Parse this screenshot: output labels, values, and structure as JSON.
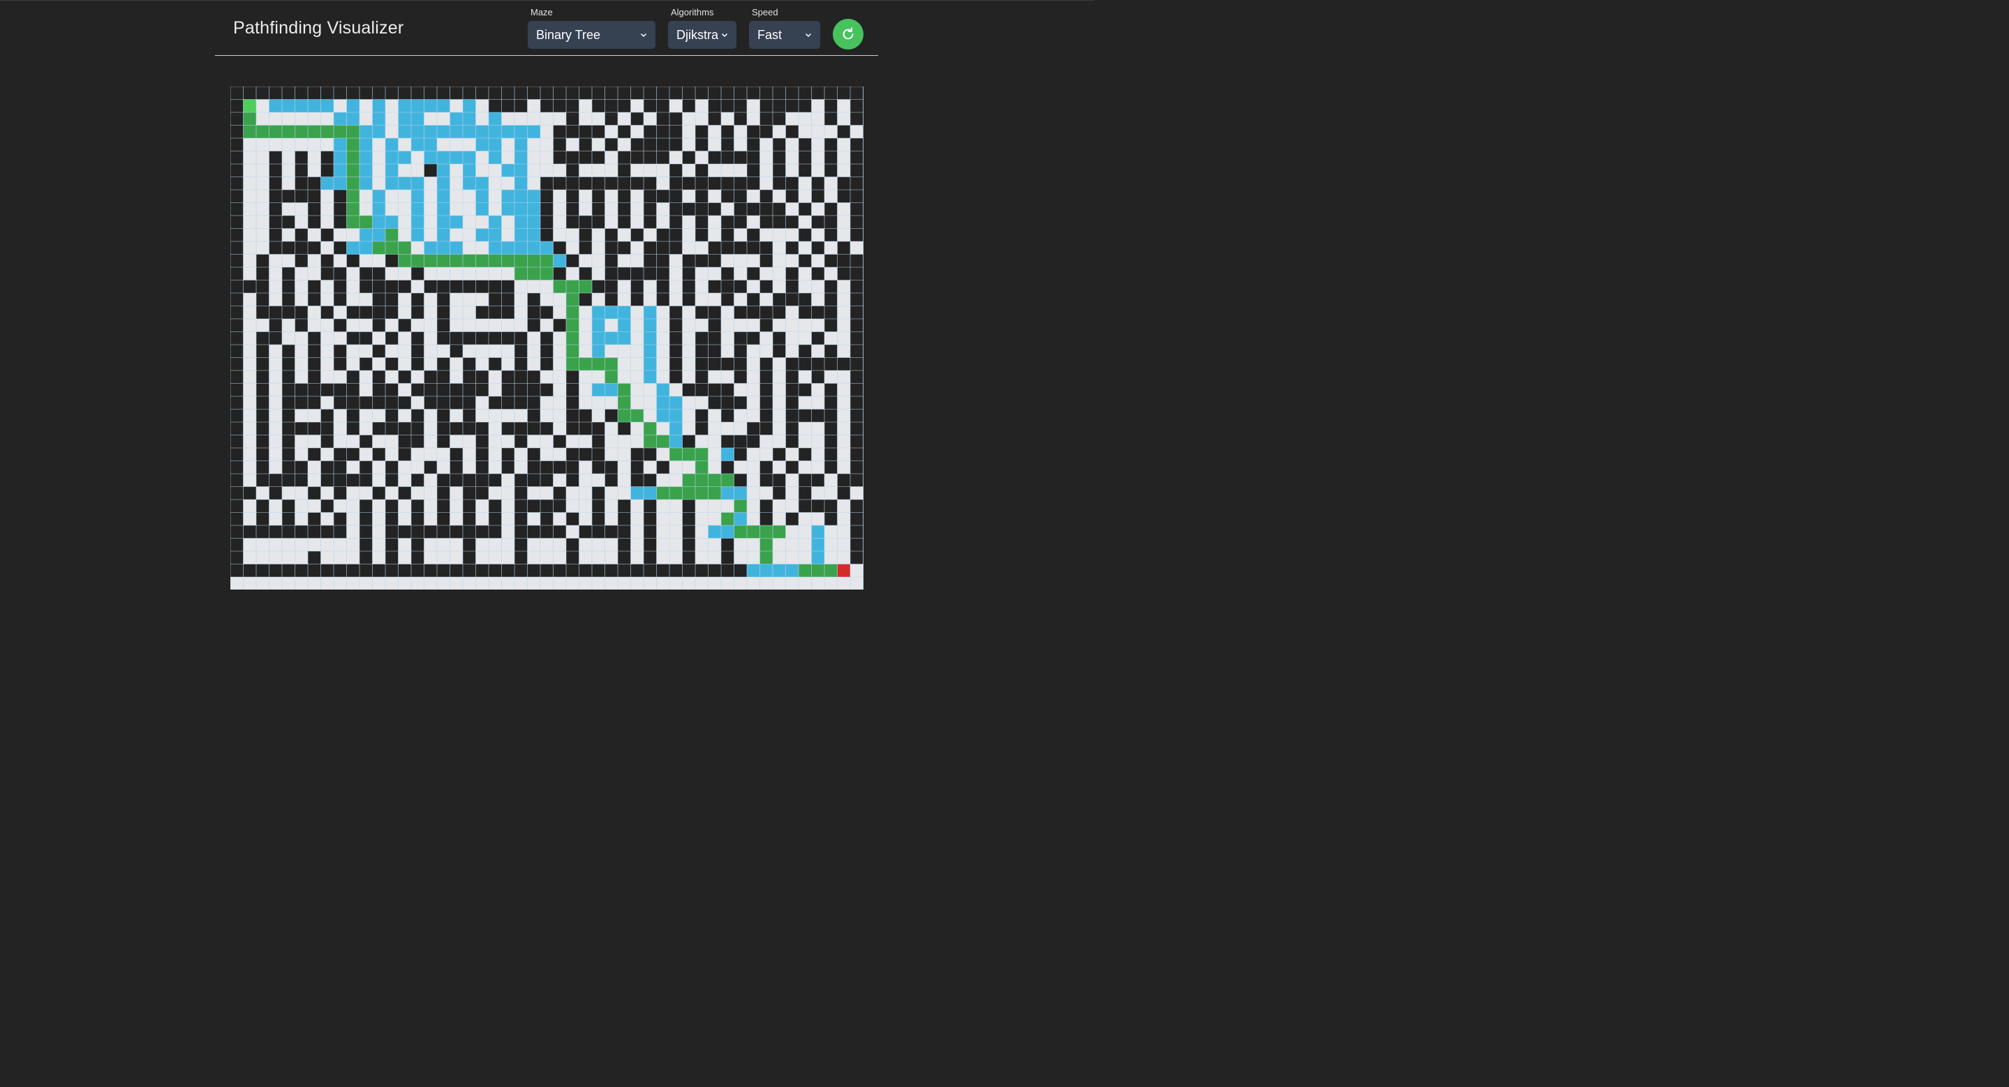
{
  "app": {
    "title": "Pathfinding Visualizer"
  },
  "controls": {
    "maze": {
      "label": "Maze",
      "value": "Binary Tree"
    },
    "algorithm": {
      "label": "Algorithms",
      "value": "Djikstra"
    },
    "speed": {
      "label": "Speed",
      "value": "Fast"
    },
    "reset_icon": "refresh-icon"
  },
  "colors": {
    "background": "#232323",
    "empty": "#e5e7eb",
    "wall": "#232323",
    "visited": "#41b4de",
    "path": "#3ba24c",
    "start": "#4fce5c",
    "end": "#d42a2a",
    "accent": "#48c25d",
    "select_bg": "#364152"
  },
  "grid": {
    "rows": 39,
    "cols": 49,
    "start": [
      1,
      1
    ],
    "end": [
      37,
      47
    ],
    "legend": "#=wall  .=empty  v=visited  p=path  S=start  E=end",
    "cells": [
      "#################################################",
      "#S.vvvvv.v.v.vvvv.v.###.###.###.##.#.###.####.#.#",
      "#p......vv.v.vv..vv.v.....#..#.#.##..#.#.##...#.#",
      "#pppppppppvv.vvvvvvvvvvv.####.#.###.#.#.##.#...#.#",
      "#.......vpv.v.vv...vv.v..#.#.#.####.#.#.#.#.#.#.#",
      "#..#.#.#vpv.vv.vvvv.v.v..####.####.#.####.#.#.#.#",
      "#..#.#.#vpv.v..#v.v..vv...#...#...#.#...#.#.#.#.#",
      "#..#.##vvpv.vvv.v.vv..v.#########.#######.##.#.##",
      "#..####.#p.v..v.v..v.vvv#.#.#.#.###.#.##.#.#.#.##",
      "#..#..#.#p.v..v.v..v.vvv#.#.#.#.#.####.####.#.#.#",
      "#..##.#.#ppvv.v.vv..v.vv#.###.#.#.#.#.##.###.##.#",
      "#..#.#.#..vvp.v.v..vv.vv#..#.#.#.##.#.#.#...#.#.#",
      "#..####.#vvppp.vvv..vvvvv#.#.##.###..#####.#.#.#.",
      "#.#..#.#.#..#ppppppppppppv#..#..##.###...#..#.###",
      "#.#.#..##.##..#.......ppp#.#.#####.#..#.#..#.#.##",
      "###.#.#.#.####.#######...ppp##.#.#.#.###.#.#..#.#",
      "#.#.#.#.#..##.#.#...##.#..p#.#.#.#.#..#.#.###.#.#",
      "#.####.#.####.#.#..###.##.p.vvv.v.#.##.####.###.#",
      "#..#.#..#..#.#..#......#.#p.v.v.v.#..#...#....#.#",
      "#.##..#..##.#.#.#######.#.p.vvv.v.#.##.##.#..#..#",
      "#.#.#.#.#..#..#..#....#.#.p.v...v.#.##.#..#.#.#.#",
      "#.#.#.#.#.#.#.#.#.#.#.#.#.pppp..v.#.####.#.######",
      "#.#.#.#..#.#.#.##.##.###..#..p..v.#.#..#.#.#.#..#",
      "#.#.######.##.######.####.#.vvp..v.####..#.##.#.#",
      "#.#.###.######.####.####..#...p..vv..###.#.#..#.#",
      "#.#.#..#.#..#.#.#.#....#..##.#pp.vv.#.#..#.####.#",
      "#.#.####.#.####.####.####.###.#.p.v.#...##.#..#.#",
      "#.#.#..#..#..##.#..#..#..#..#...ppv#..###..#..#.#",
      "#.#.#.#.##.#.#...#.#.#.#..###..##.ppp.v#..#.#.#.#",
      "#.#.##.##.#.#..#.#.#.#.####.##.#.#..p.#..#.#..#.#",
      "#.####.####.#.#.#####.###.#..#.##..pppp#.##.##.##",
      "##.#..#.#..#.#..#.##..#..#..#..vvpppppvv..#.#..#.",
      "#.#.#..#..#.#.#.#.#.#.####..#.#.#..#...p.#..###.#",
      "#.#.#.#.#.#.#.#.#.#.#.#.#.#.#.#.#..#..pv.#.#..#.#",
      "#########.#.#########.####.####.#..#.vvpppp..v..#",
      "#.........#.#.#...#...#...#...#.#..#..#..p...v..#",
      "#.....#...#.#.#...#...#...#...#.#..#..#..p...v..#",
      "########################################vvvvpppE.",
      "................................................."
    ]
  }
}
